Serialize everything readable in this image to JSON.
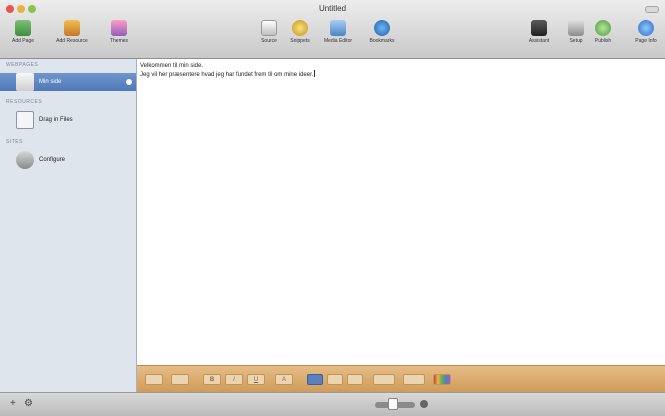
{
  "window": {
    "title": "Untitled"
  },
  "toolbar": {
    "add_page": "Add Page",
    "add_resource": "Add Resource",
    "themes": "Themes",
    "source": "Source",
    "snippets": "Snippets",
    "media_editor": "Media Editor",
    "bookmarks": "Bookmarks",
    "assistant": "Assistant",
    "setup": "Setup",
    "publish": "Publish",
    "page_info": "Page Info"
  },
  "sidebar": {
    "webpages_header": "WEBPAGES",
    "selected_page": "Min side",
    "resources_header": "RESOURCES",
    "drag_files": "Drag in Files",
    "sites_header": "SITES",
    "configure": "Configure"
  },
  "editor": {
    "line1": "Velkommen til min side.",
    "line2": "Jeg vil her præsentere hvad jeg har fundet frem til om mine ideer."
  },
  "format_bar": {
    "bold": "B",
    "italic": "I",
    "underline": "U",
    "font_size": "A",
    "colors": [
      "#ecd4b0",
      "#5a7fbf",
      "#d0423a",
      "#e9b641",
      "#5eae52",
      "#9b5fc0"
    ]
  },
  "bottom": {
    "add": "+",
    "gear": "⚙"
  }
}
